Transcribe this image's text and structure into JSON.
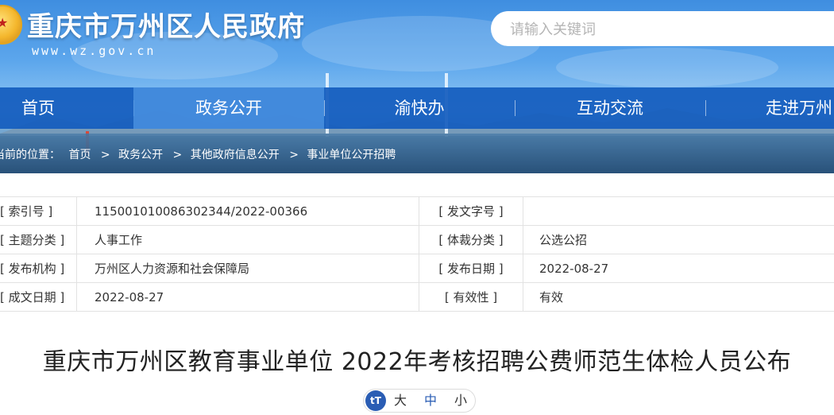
{
  "header": {
    "site_title": "重庆市万州区人民政府",
    "site_domain": "www.wz.gov.cn",
    "emblem_glyph": "★",
    "search_placeholder": "请输入关键词"
  },
  "nav": {
    "items": [
      {
        "label": "首页"
      },
      {
        "label": "政务公开",
        "active": true
      },
      {
        "label": "渝快办"
      },
      {
        "label": "互动交流"
      },
      {
        "label": "走进万州"
      }
    ]
  },
  "breadcrumb": {
    "prefix": "当前的位置：",
    "items": [
      "首页",
      "政务公开",
      "其他政府信息公开",
      "事业单位公开招聘"
    ],
    "separator": ">"
  },
  "meta": {
    "index_no_label": "[ 索引号 ]",
    "index_no_value": "11500101008630234 4/2022-00366",
    "doc_no_label": "[ 发文字号 ]",
    "doc_no_value": "",
    "topic_label": "[ 主题分类 ]",
    "topic_value": "人事工作",
    "genre_label": "[ 体裁分类 ]",
    "genre_value": "公选公招",
    "publisher_label": "[ 发布机构 ]",
    "publisher_value": "万州区人力资源和社会保障局",
    "publish_date_label": "[ 发布日期 ]",
    "publish_date_value": "2022-08-27",
    "written_date_label": "[ 成文日期 ]",
    "written_date_value": "2022-08-27",
    "validity_label": "[ 有效性 ]",
    "validity_value": "有效"
  },
  "article": {
    "title": "重庆市万州区教育事业单位 2022年考核招聘公费师范生体检人员公布"
  },
  "font_switch": {
    "icon_glyph": "tT",
    "large": "大",
    "medium": "中",
    "small": "小"
  },
  "colors": {
    "nav_bg": "#145cbe",
    "nav_active": "#4991e1",
    "accent": "#2a5db4"
  }
}
